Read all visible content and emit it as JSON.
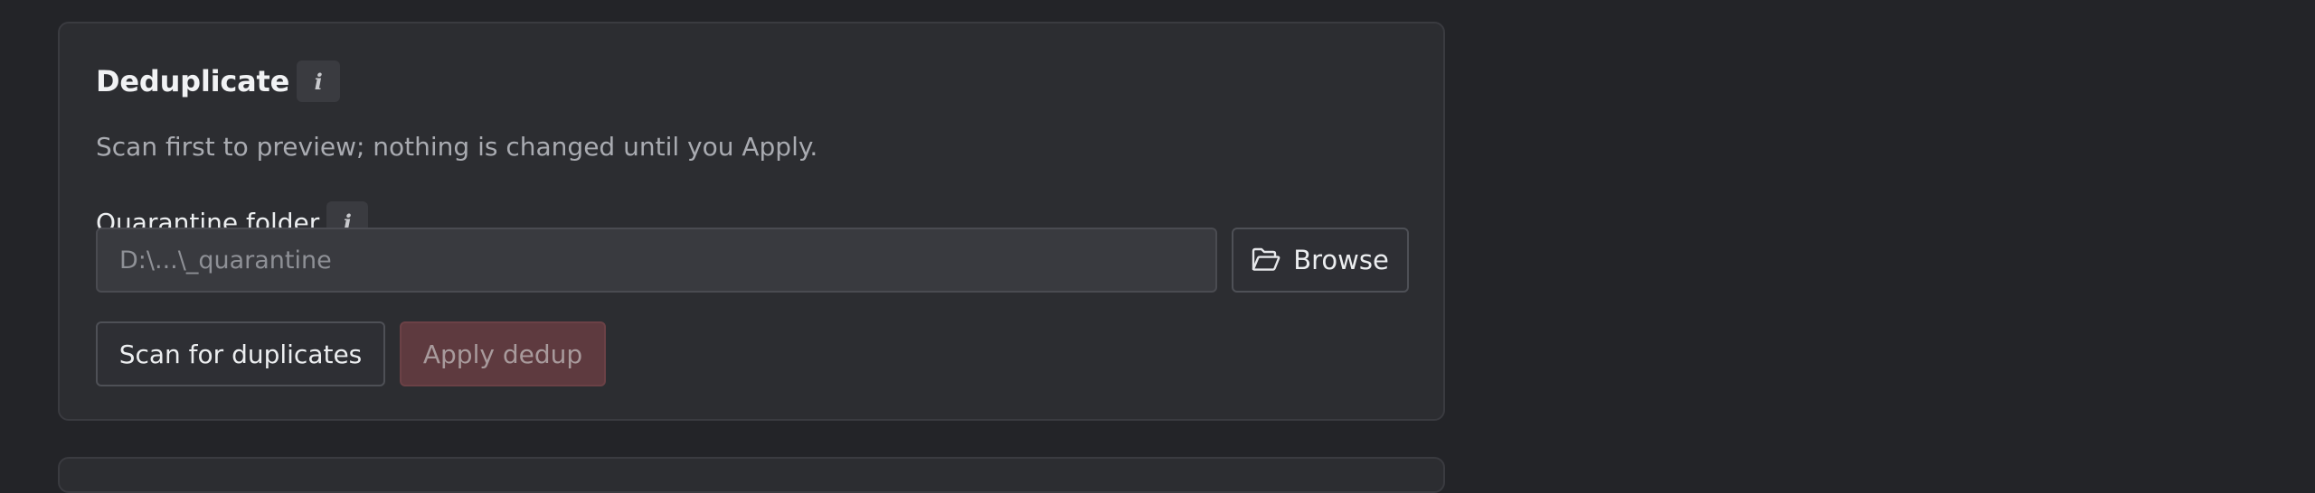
{
  "card": {
    "title": "Deduplicate",
    "title_info_icon": "info-icon",
    "subtitle": "Scan first to preview; nothing is changed until you Apply."
  },
  "quarantine": {
    "label": "Quarantine folder",
    "label_info_icon": "info-icon",
    "placeholder": "D:\\...\\_quarantine",
    "value": "",
    "browse_label": "Browse",
    "browse_icon": "folder-open-icon"
  },
  "actions": {
    "scan_label": "Scan for duplicates",
    "apply_label": "Apply dedup",
    "apply_enabled": false
  },
  "colors": {
    "background": "#232428",
    "card": "#2c2d31",
    "apply_disabled": "#5e3a3f"
  }
}
